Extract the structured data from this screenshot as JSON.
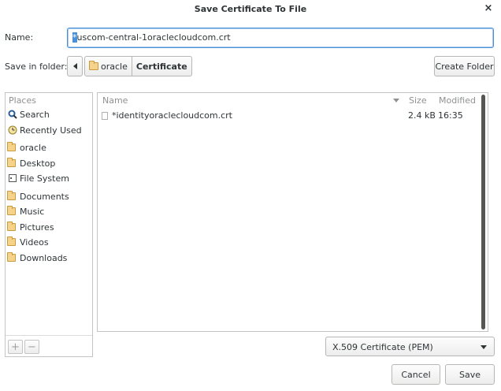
{
  "window": {
    "title": "Save Certificate To File",
    "close_glyph": "×"
  },
  "name": {
    "label": "Name:",
    "value_selected": "*",
    "value_rest": "uscom-central-1oraclecloudcom.crt"
  },
  "save_in": {
    "label": "Save in folder:",
    "path": [
      {
        "label": "oracle",
        "icon": "folder-icon"
      },
      {
        "label": "Certificate"
      }
    ],
    "create_folder_label": "Create Folder"
  },
  "places": {
    "header": "Places",
    "items": [
      {
        "label": "Search",
        "icon": "search-icon"
      },
      {
        "label": "Recently Used",
        "icon": "clock-icon"
      },
      {
        "label": "oracle",
        "icon": "folder-icon"
      },
      {
        "label": "Desktop",
        "icon": "folder-icon"
      },
      {
        "label": "File System",
        "icon": "drive-icon"
      },
      {
        "label": "Documents",
        "icon": "folder-icon"
      },
      {
        "label": "Music",
        "icon": "folder-icon"
      },
      {
        "label": "Pictures",
        "icon": "folder-icon"
      },
      {
        "label": "Videos",
        "icon": "folder-icon"
      },
      {
        "label": "Downloads",
        "icon": "folder-icon"
      }
    ],
    "add_glyph": "+",
    "remove_glyph": "−"
  },
  "files": {
    "columns": {
      "name": "Name",
      "size": "Size",
      "modified": "Modified"
    },
    "rows": [
      {
        "name": "*identityoraclecloudcom.crt",
        "size": "2.4 kB",
        "modified": "16:35"
      }
    ]
  },
  "filter": {
    "selected": "X.509 Certificate (PEM)"
  },
  "actions": {
    "cancel": "Cancel",
    "save": "Save"
  },
  "colors": {
    "accent": "#4a90d9",
    "scrollbar": "#555753"
  }
}
